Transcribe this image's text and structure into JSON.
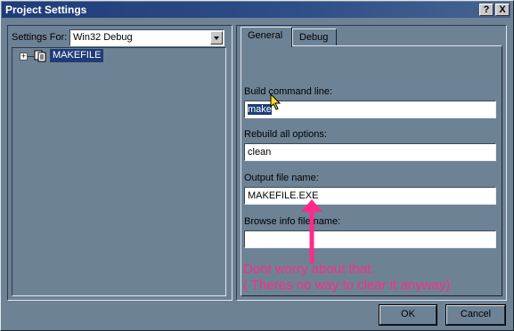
{
  "window": {
    "title": "Project Settings",
    "help_btn": "?",
    "close_btn": "X"
  },
  "settings_for": {
    "label": "Settings For:",
    "value": "Win32 Debug"
  },
  "tree": {
    "items": [
      {
        "expander": "+",
        "label": "MAKEFILE"
      }
    ]
  },
  "tabs": [
    {
      "label": "General",
      "active": true
    },
    {
      "label": "Debug",
      "active": false
    }
  ],
  "fields": {
    "build_command": {
      "label": "Build command line:",
      "value": "make"
    },
    "rebuild_all": {
      "label": "Rebuild all options:",
      "value": "clean"
    },
    "output_file": {
      "label": "Output file name:",
      "value": "MAKEFILE.EXE"
    },
    "browse_info": {
      "label": "Browse info file name:",
      "value": ""
    }
  },
  "annotation": {
    "line1": "Dont worry about that.",
    "line2": "( Theres no way to clear it anyway)",
    "color": "#ff2a8a"
  },
  "buttons": {
    "ok": "OK",
    "cancel": "Cancel"
  },
  "colors": {
    "dialog_bg": "#6e8296",
    "title_bg": "#1f3c78"
  }
}
